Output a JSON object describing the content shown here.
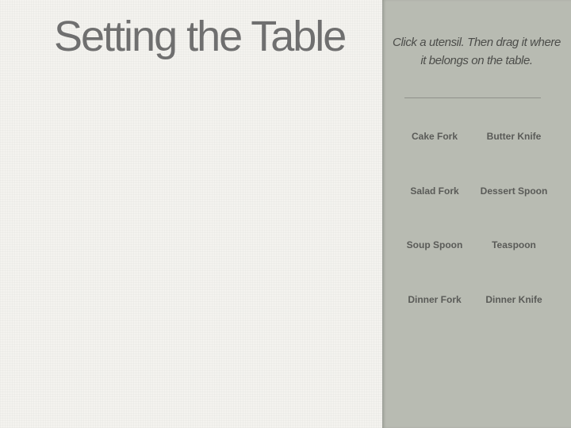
{
  "title": "Setting the Table",
  "panel": {
    "instructions": "Click a utensil. Then drag it where it belongs on the table."
  },
  "utensils": [
    {
      "label": "Cake Fork"
    },
    {
      "label": "Butter Knife"
    },
    {
      "label": "Salad Fork"
    },
    {
      "label": "Dessert Spoon"
    },
    {
      "label": "Soup Spoon"
    },
    {
      "label": "Teaspoon"
    },
    {
      "label": "Dinner Fork"
    },
    {
      "label": "Dinner Knife"
    }
  ],
  "colors": {
    "canvas_background": "#f4f3ef",
    "panel_background": "#b8bbb2",
    "title_text": "#6f6f6f",
    "utensil_text": "#5a5b58"
  }
}
